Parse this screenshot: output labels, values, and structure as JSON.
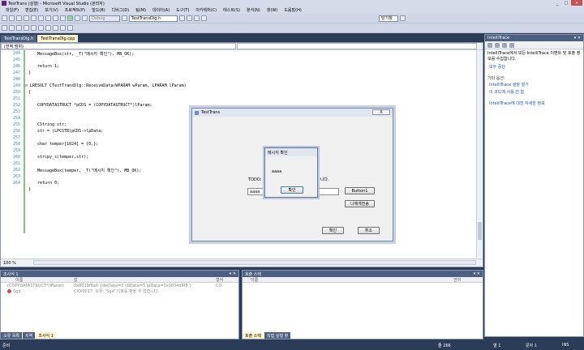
{
  "window": {
    "title": "TestTrans (실행) - Microsoft Visual Studio (관리자)"
  },
  "menu": [
    "파일(F)",
    "편집(E)",
    "보기(V)",
    "프로젝트(P)",
    "빌드(B)",
    "디버그(D)",
    "팀(M)",
    "데이터(A)",
    "도구(T)",
    "아키텍처(C)",
    "테스트(S)",
    "분석(N)",
    "창(W)",
    "도움말(H)"
  ],
  "toolbar": {
    "config": "Debug",
    "target": "TestTransDlg.h",
    "search": "닫기창"
  },
  "tabs": [
    {
      "label": "TestTransDlg.h"
    },
    {
      "label": "TestTransDlg.cpp"
    }
  ],
  "editor": {
    "scope_combo": "(전역 범위)",
    "member_combo": "",
    "zoom": "100 %",
    "lines": [
      {
        "n": "244",
        "code": "MessageBox(str, _T(\"메시지 확인\"), MB_OK);"
      },
      {
        "n": "245",
        "code": ""
      },
      {
        "n": "246",
        "code": "return 1;"
      },
      {
        "n": "247",
        "code": "}"
      },
      {
        "n": "248",
        "code": ""
      },
      {
        "n": "249",
        "code": "LRESULT CTestTransDlg::ReceiveData(WPARAM wParam, LPARAM lParam)"
      },
      {
        "n": "250",
        "code": "{"
      },
      {
        "n": "251",
        "code": "COPYDATASTRUCT *pCDS = (COPYDATASTRUCT*)lParam;"
      },
      {
        "n": "252",
        "code": ""
      },
      {
        "n": "253",
        "code": "CString str;"
      },
      {
        "n": "254",
        "code": "str = (LPCSTR)pCDS->lpData;"
      },
      {
        "n": "255",
        "code": ""
      },
      {
        "n": "256",
        "code": "char temper[1024] = {0,};"
      },
      {
        "n": "257",
        "code": ""
      },
      {
        "n": "258",
        "code": "strcpy_s(temper,str);"
      },
      {
        "n": "259",
        "code": ""
      },
      {
        "n": "260",
        "code": "MessageBox(temper, _T(\"메시지 확인\"), MB_OK);"
      },
      {
        "n": "261",
        "code": ""
      },
      {
        "n": "262",
        "code": "return 0;"
      },
      {
        "n": "263",
        "code": "}"
      },
      {
        "n": "264",
        "code": ""
      }
    ]
  },
  "intellitrace": {
    "title": "IntelliTrace",
    "desc": "IntelliTrace에서 모든 IntelliTrace 이벤트 및 호출 정보를 수집합니다.",
    "stop_link": "모두 중단",
    "other_label": "기타 옵션:",
    "links": [
      "IntelliTrace 설정 열기",
      "이 코드에 사용 안 함"
    ],
    "more_link": "IntelliTrace에 대한 자세한 정보"
  },
  "dialog": {
    "title": "TestTrans",
    "todo": "TODO: 여기에 대화 상자 컨트롤을 배치합니다.",
    "input_value": "aaaa",
    "button1": "Button1",
    "button2": "나에게전송",
    "ok": "확인",
    "cancel": "취소",
    "close": "X"
  },
  "msgbox": {
    "title": "메시지 확인",
    "text": "aaaa",
    "ok": "확인"
  },
  "autos": {
    "title": "조사식 1",
    "cols": [
      "이름",
      "값",
      "형식"
    ],
    "rows": [
      {
        "name": "(COPYDATASTRUCT*)lParam",
        "value": "0x0019f8a0 {dwData=0 cbData=5 lpData=0x0034d9f8 }",
        "type": "CO"
      },
      {
        "name": "Sgd",
        "value": "CXX0017: 오류: 'Sgd' 기호를 찾을 수 없습니다.",
        "type": ""
      }
    ]
  },
  "callstack": {
    "title": "호출 스택",
    "cols": [
      "이름",
      "언어"
    ]
  },
  "bottom_tabs_left": [
    "오류 목록",
    "지역",
    "조사식 1"
  ],
  "bottom_tabs_right": [
    "호출 스택",
    "직접 실행 창"
  ],
  "status": {
    "ready": "준비",
    "line": "줄 266",
    "col": "열 1",
    "ch": "문자 1",
    "ins": "INS"
  },
  "colors": {
    "chrome": "#2b3c59",
    "active_tab": "#fef6cc",
    "breakpoint_red": "#c75050"
  }
}
